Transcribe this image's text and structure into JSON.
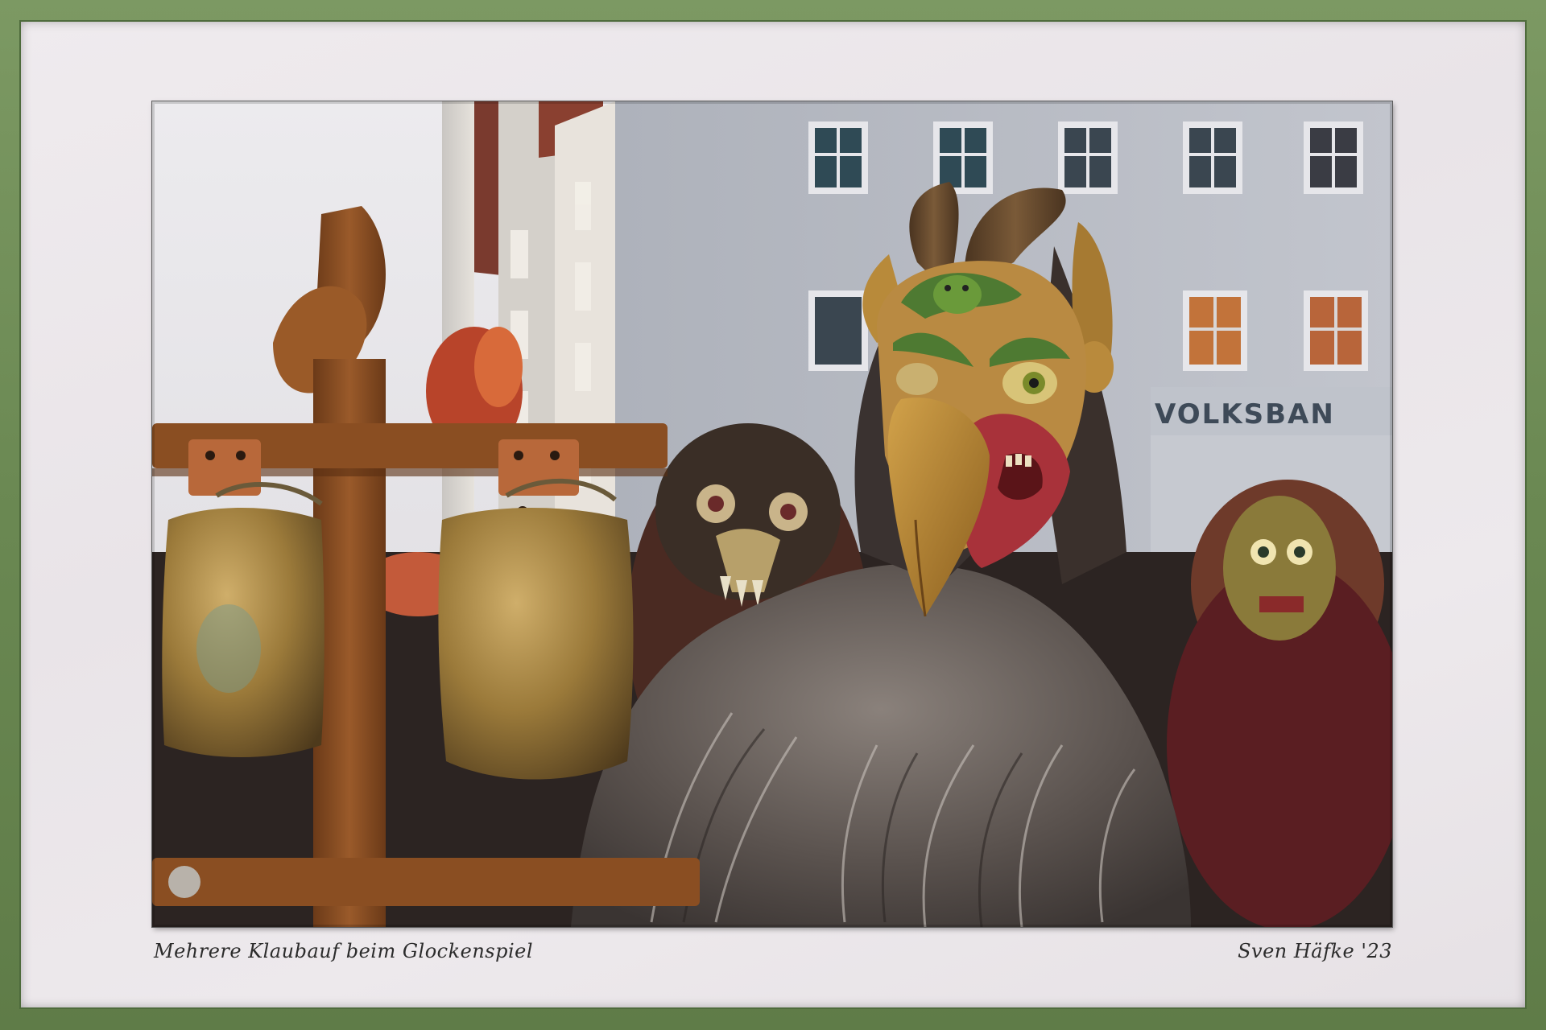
{
  "image": {
    "caption": "Mehrere Klaubauf beim Glockenspiel",
    "signature": "Sven Häfke '23",
    "sign_text": "VOLKSBAN",
    "colors": {
      "frame": "#6b8a55",
      "mat": "#ece8eb",
      "sky": "#ebe9ec",
      "facade": "#b9bdc6",
      "wood": "#8a4f25",
      "brass": "#9a7a3a",
      "fur": "#6a625e",
      "mask_gold": "#b78a3c",
      "mask_red": "#a8323a"
    }
  }
}
